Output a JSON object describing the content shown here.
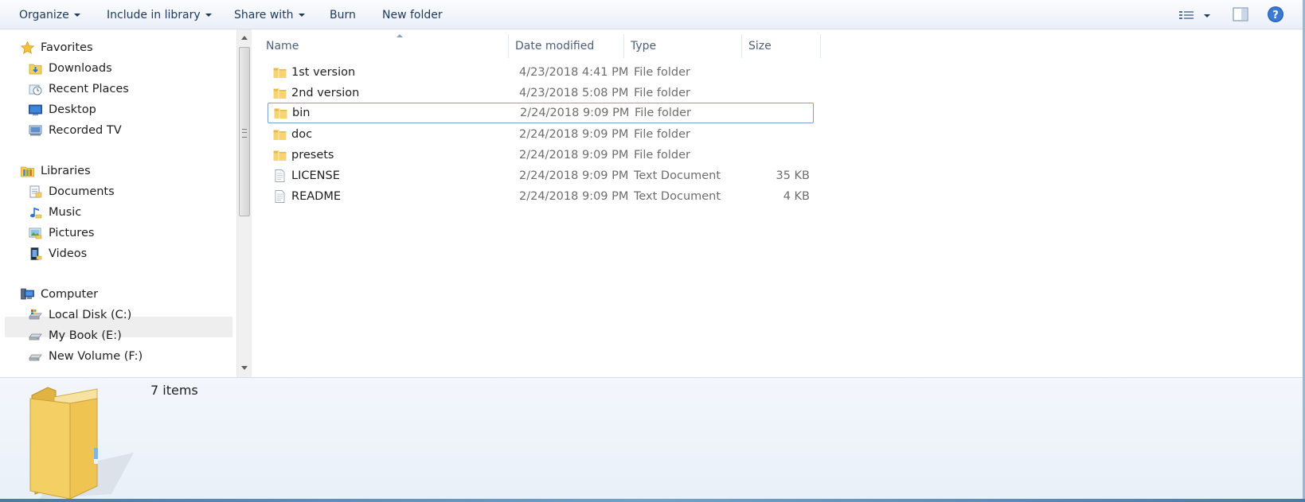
{
  "toolbar": {
    "organize": "Organize",
    "include_in_library": "Include in library",
    "share_with": "Share with",
    "burn": "Burn",
    "new_folder": "New folder"
  },
  "nav": {
    "favorites": {
      "header": "Favorites",
      "items": [
        "Downloads",
        "Recent Places",
        "Desktop",
        "Recorded TV"
      ]
    },
    "libraries": {
      "header": "Libraries",
      "items": [
        "Documents",
        "Music",
        "Pictures",
        "Videos"
      ]
    },
    "computer": {
      "header": "Computer",
      "items": [
        "Local Disk (C:)",
        "My Book (E:)",
        "New Volume (F:)"
      ]
    }
  },
  "columns": {
    "name": "Name",
    "date": "Date modified",
    "type": "Type",
    "size": "Size"
  },
  "files": [
    {
      "name": "1st version",
      "date": "4/23/2018 4:41 PM",
      "type": "File folder",
      "size": "",
      "icon": "folder-icon"
    },
    {
      "name": "2nd version",
      "date": "4/23/2018 5:08 PM",
      "type": "File folder",
      "size": "",
      "icon": "folder-icon"
    },
    {
      "name": "bin",
      "date": "2/24/2018 9:09 PM",
      "type": "File folder",
      "size": "",
      "icon": "folder-icon"
    },
    {
      "name": "doc",
      "date": "2/24/2018 9:09 PM",
      "type": "File folder",
      "size": "",
      "icon": "folder-icon"
    },
    {
      "name": "presets",
      "date": "2/24/2018 9:09 PM",
      "type": "File folder",
      "size": "",
      "icon": "folder-icon"
    },
    {
      "name": "LICENSE",
      "date": "2/24/2018 9:09 PM",
      "type": "Text Document",
      "size": "35 KB",
      "icon": "text-document-icon"
    },
    {
      "name": "README",
      "date": "2/24/2018 9:09 PM",
      "type": "Text Document",
      "size": "4 KB",
      "icon": "text-document-icon"
    }
  ],
  "details": {
    "item_count": "7 items"
  },
  "colors": {
    "toolbar_text": "#1e395b",
    "folder_yellow": "#f3cf5d",
    "selection_border": "#7da2ce"
  }
}
